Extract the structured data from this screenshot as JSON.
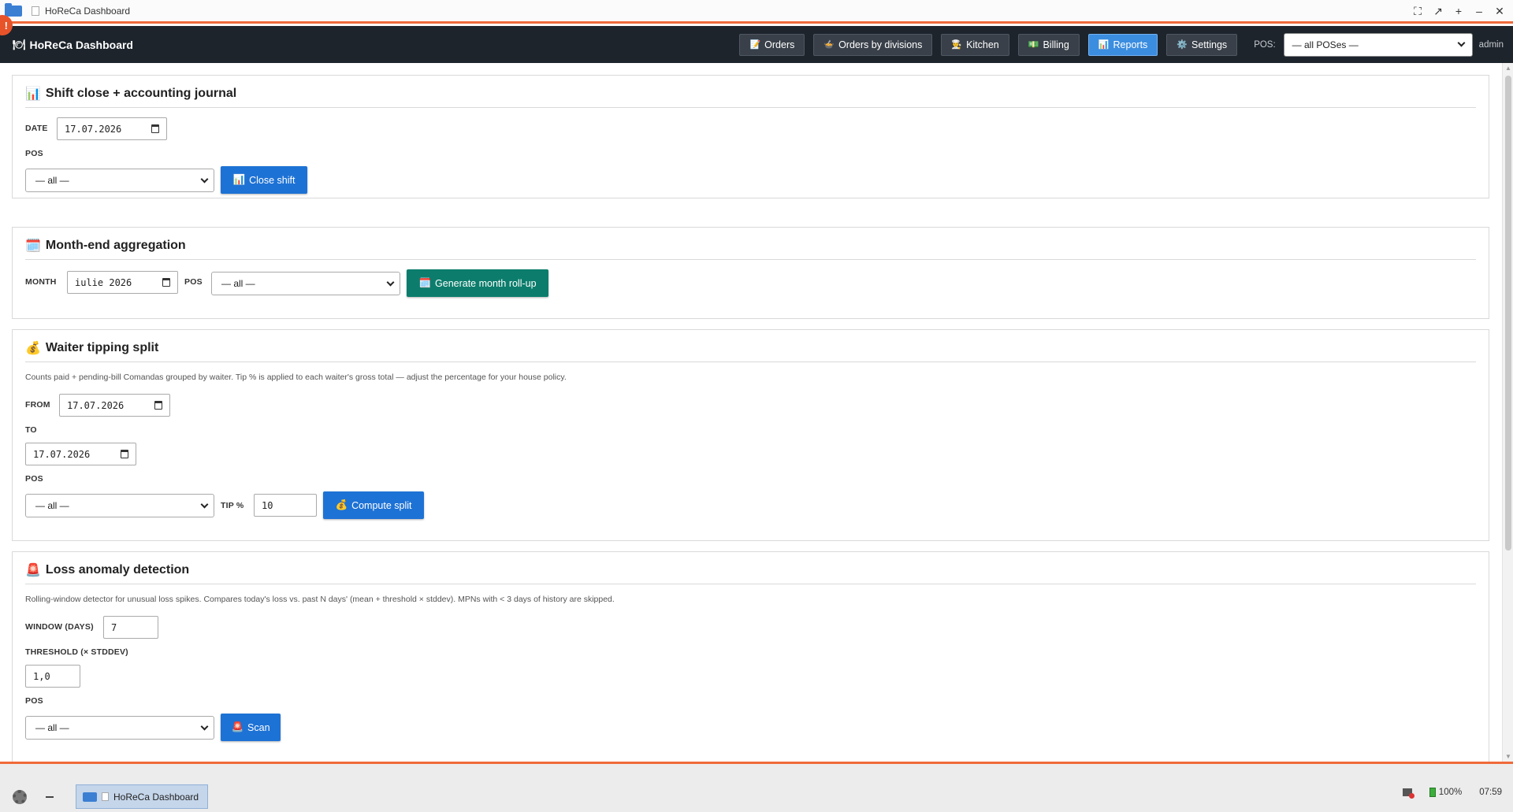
{
  "window": {
    "title": "HoReCa Dashboard",
    "notification_count": "!"
  },
  "app": {
    "brand_icon": "🍽",
    "brand": "HoReCa Dashboard"
  },
  "nav": [
    {
      "icon": "📝",
      "label": "Orders"
    },
    {
      "icon": "🍲",
      "label": "Orders by divisions"
    },
    {
      "icon": "👨‍🍳",
      "label": "Kitchen"
    },
    {
      "icon": "💵",
      "label": "Billing"
    },
    {
      "icon": "📊",
      "label": "Reports",
      "active": true
    },
    {
      "icon": "⚙️",
      "label": "Settings"
    }
  ],
  "header": {
    "pos_label": "POS:",
    "pos_value": "— all POSes —",
    "user": "admin"
  },
  "shift": {
    "icon": "📊",
    "title": "Shift close + accounting journal",
    "date_label": "DATE",
    "date_value": "17.07.2026",
    "pos_label": "POS",
    "pos_value": "— all —",
    "button_icon": "📊",
    "button": "Close shift"
  },
  "month": {
    "icon": "🗓️",
    "title": "Month-end aggregation",
    "month_label": "MONTH",
    "month_value": "iulie 2026",
    "pos_label": "POS",
    "pos_value": "— all —",
    "button_icon": "🗓️",
    "button": "Generate month roll-up"
  },
  "tips": {
    "icon": "💰",
    "title": "Waiter tipping split",
    "description": "Counts paid + pending-bill Comandas grouped by waiter. Tip % is applied to each waiter's gross total — adjust the percentage for your house policy.",
    "from_label": "FROM",
    "from_value": "17.07.2026",
    "to_label": "TO",
    "to_value": "17.07.2026",
    "pos_label": "POS",
    "pos_value": "— all —",
    "tip_label": "TIP %",
    "tip_value": "10",
    "button_icon": "💰",
    "button": "Compute split"
  },
  "loss": {
    "icon": "🚨",
    "title": "Loss anomaly detection",
    "description": "Rolling-window detector for unusual loss spikes. Compares today's loss vs. past N days' (mean + threshold × stddev). MPNs with < 3 days of history are skipped.",
    "window_label": "WINDOW (DAYS)",
    "window_value": "7",
    "threshold_label": "THRESHOLD (× STDDEV)",
    "threshold_value": "1,0",
    "pos_label": "POS",
    "pos_value": "— all —",
    "button_icon": "🚨",
    "button": "Scan"
  },
  "taskbar": {
    "task_label": "HoReCa Dashboard",
    "battery": "100%",
    "clock": "07:59"
  }
}
